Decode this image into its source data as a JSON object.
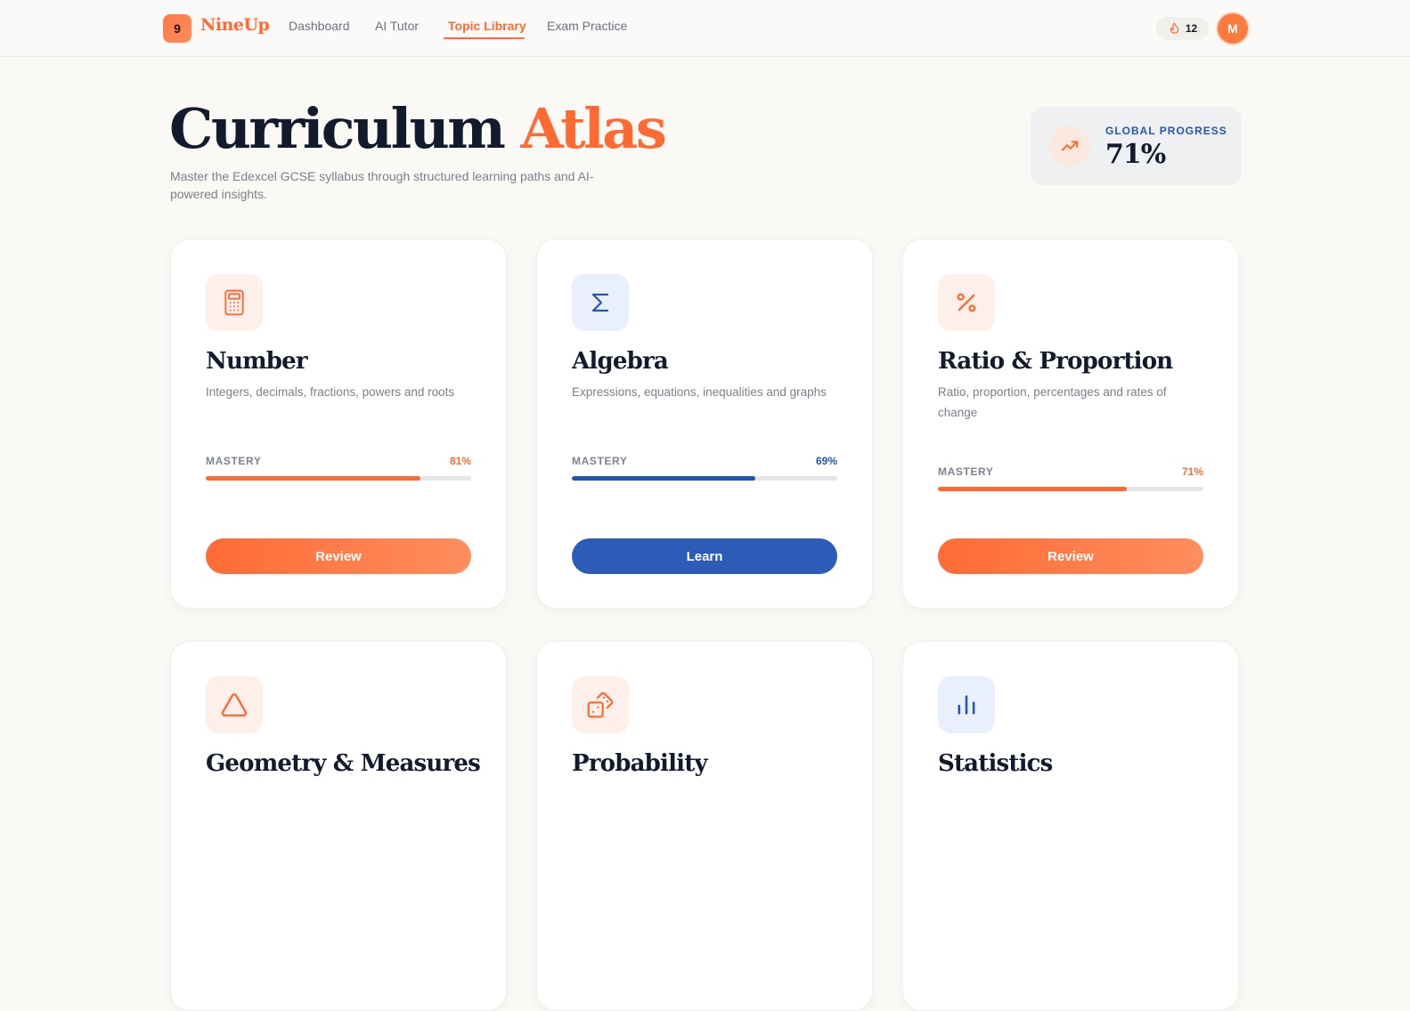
{
  "brand": {
    "badge": "9",
    "name": "NineUp"
  },
  "nav": {
    "links": [
      "Dashboard",
      "AI Tutor",
      "Topic Library",
      "Exam Practice"
    ],
    "active": "Topic Library"
  },
  "streak": {
    "icon": "flame-icon",
    "count": "12"
  },
  "avatar": {
    "initial": "M"
  },
  "hero": {
    "title_main": "Curriculum",
    "title_accent": "Atlas",
    "subtitle": "Master the Edexcel GCSE syllabus through structured learning paths and AI-powered insights."
  },
  "global_progress": {
    "label": "GLOBAL PROGRESS",
    "value": "71%",
    "icon": "trending-up-icon"
  },
  "colors": {
    "accent": "#ff6a33",
    "blue": "#2c5cb8"
  },
  "topics": [
    {
      "title": "Number",
      "desc": "Integers, decimals, fractions, powers and roots",
      "mastery_label": "MASTERY",
      "mastery": "81%",
      "mastery_value": 0.81,
      "action": "Review",
      "theme": "orange",
      "icon": "calculator-icon"
    },
    {
      "title": "Algebra",
      "desc": "Expressions, equations, inequalities and graphs",
      "mastery_label": "MASTERY",
      "mastery": "69%",
      "mastery_value": 0.69,
      "action": "Learn",
      "theme": "blue",
      "icon": "sigma-icon"
    },
    {
      "title": "Ratio & Proportion",
      "desc": "Ratio, proportion, percentages and rates of change",
      "mastery_label": "MASTERY",
      "mastery": "71%",
      "mastery_value": 0.71,
      "action": "Review",
      "theme": "orange",
      "icon": "percent-icon"
    },
    {
      "title": "Geometry & Measures",
      "icon": "triangle-icon",
      "theme": "orange"
    },
    {
      "title": "Probability",
      "icon": "dice-icon",
      "theme": "orange"
    },
    {
      "title": "Statistics",
      "icon": "bar-chart-icon",
      "theme": "blue"
    }
  ]
}
